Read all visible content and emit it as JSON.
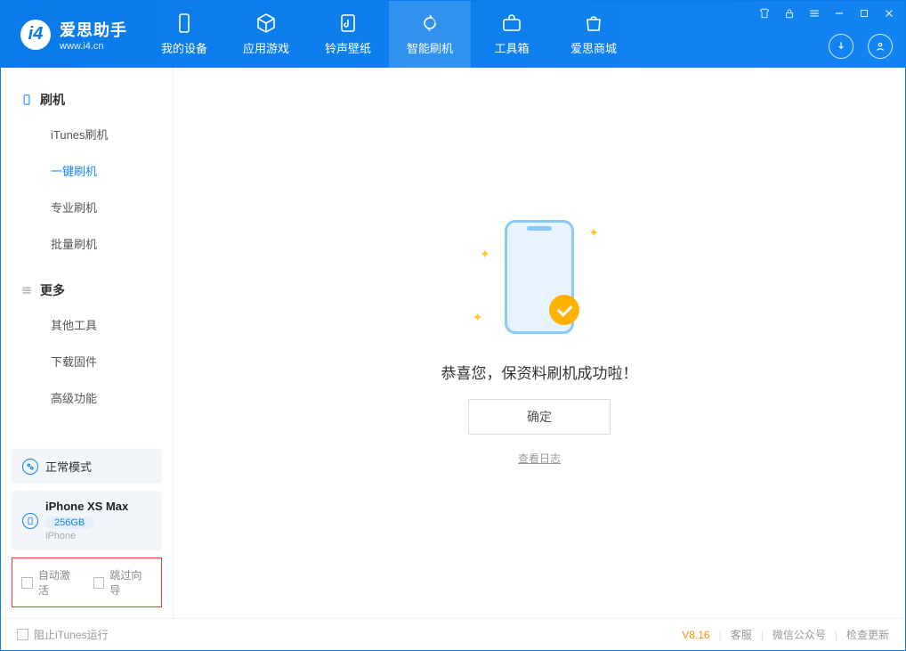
{
  "app": {
    "name_cn": "爱思助手",
    "name_en": "www.i4.cn"
  },
  "toolbar": {
    "tabs": [
      "我的设备",
      "应用游戏",
      "铃声壁纸",
      "智能刷机",
      "工具箱",
      "爱思商城"
    ],
    "active_index": 3
  },
  "sidebar": {
    "section_flash": "刷机",
    "section_more": "更多",
    "flash_items": [
      "iTunes刷机",
      "一键刷机",
      "专业刷机",
      "批量刷机"
    ],
    "flash_active_index": 1,
    "more_items": [
      "其他工具",
      "下载固件",
      "高级功能"
    ],
    "mode_label": "正常模式",
    "device": {
      "name": "iPhone XS Max",
      "storage": "256GB",
      "type": "iPhone"
    },
    "options": {
      "auto_activate": "自动激活",
      "skip_guide": "跳过向导"
    }
  },
  "main": {
    "message": "恭喜您，保资料刷机成功啦！",
    "confirm": "确定",
    "view_log": "查看日志"
  },
  "footer": {
    "block_itunes": "阻止iTunes运行",
    "version": "V8.16",
    "links": [
      "客服",
      "微信公众号",
      "检查更新"
    ]
  }
}
